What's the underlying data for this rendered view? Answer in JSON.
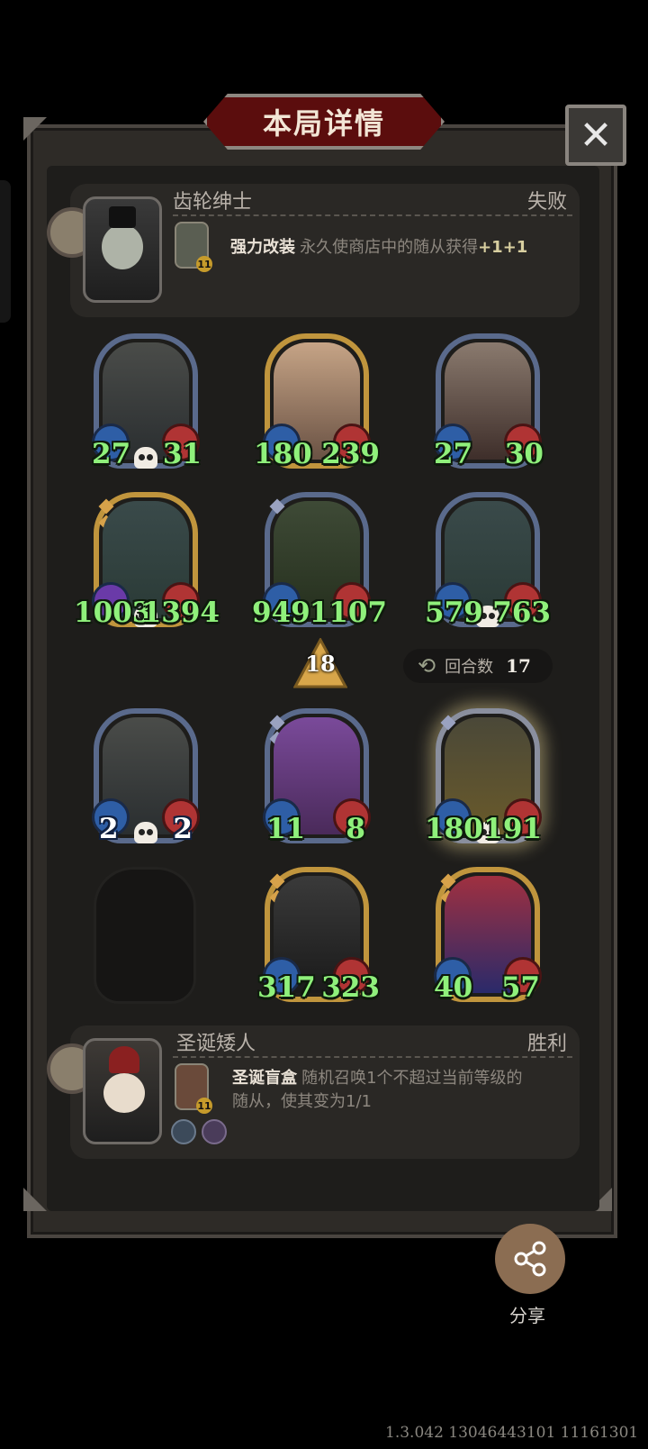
{
  "title": "本局详情",
  "close_label": "✕",
  "top_hero": {
    "name": "齿轮绅士",
    "result": "失败",
    "skill_title": "强力改装",
    "skill_desc": "永久使商店中的随从获得",
    "skill_plus": "+1+1",
    "skill_level": "11"
  },
  "top_row1": [
    {
      "atk": "27",
      "hp": "31",
      "skull": true,
      "frame": "blue"
    },
    {
      "atk": "180",
      "hp": "239",
      "skull": false,
      "frame": "gold"
    },
    {
      "atk": "27",
      "hp": "30",
      "skull": false,
      "frame": "blue"
    }
  ],
  "top_row2": [
    {
      "atk": "1003",
      "hp": "1394",
      "skull": true,
      "frame": "gold"
    },
    {
      "atk": "949",
      "hp": "1107",
      "skull": false,
      "frame": "blue"
    },
    {
      "atk": "579",
      "hp": "763",
      "skull": true,
      "frame": "blue"
    }
  ],
  "level": "18",
  "turns": {
    "label": "回合数",
    "value": "17"
  },
  "bottom_row1": [
    {
      "atk": "2",
      "hp": "2",
      "skull": true,
      "frame": "blue"
    },
    {
      "atk": "11",
      "hp": "8",
      "skull": false,
      "frame": "blue"
    },
    {
      "atk": "180",
      "hp": "191",
      "skull": true,
      "frame": "glow"
    }
  ],
  "bottom_row2": [
    {
      "atk": "317",
      "hp": "323",
      "skull": false,
      "frame": "gold"
    },
    {
      "atk": "40",
      "hp": "57",
      "skull": false,
      "frame": "gold"
    }
  ],
  "bottom_hero": {
    "name": "圣诞矮人",
    "result": "胜利",
    "skill_title": "圣诞盲盒",
    "skill_desc_1": "随机召唤1个不超过当前等级的",
    "skill_desc_2": "随从，使其变为1/1",
    "skill_level": "11"
  },
  "share_label": "分享",
  "version": "1.3.042 13046443101 11161301",
  "colors": {
    "stat_green": "#8ff07b",
    "banner_red": "#5b0d0d",
    "gold_frame": "#c0953d"
  }
}
